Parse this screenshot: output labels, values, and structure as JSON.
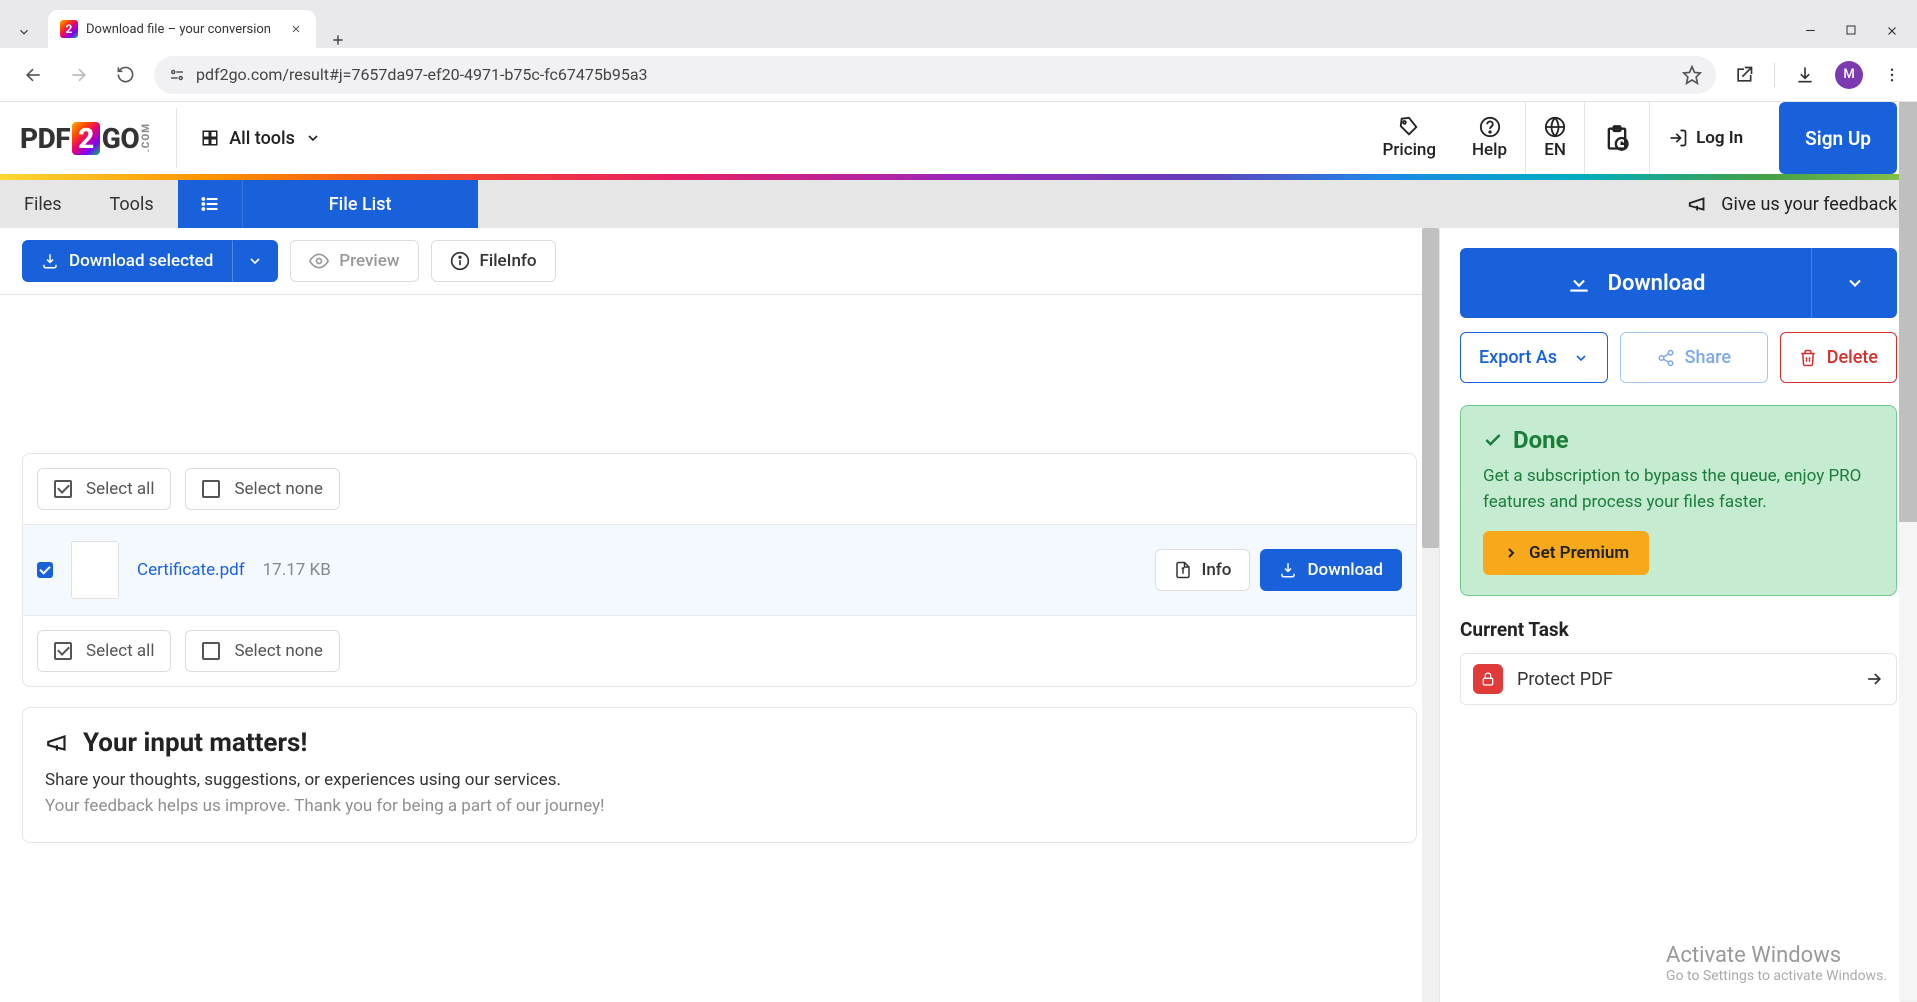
{
  "browser": {
    "tab_title": "Download file – your conversion",
    "url": "pdf2go.com/result#j=7657da97-ef20-4971-b75c-fc67475b95a3",
    "profile_initial": "M"
  },
  "header": {
    "logo_pdf": "PDF",
    "logo_2": "2",
    "logo_go": "GO",
    "logo_com": ".COM",
    "all_tools": "All tools",
    "pricing": "Pricing",
    "help": "Help",
    "lang": "EN",
    "login": "Log In",
    "signup": "Sign Up"
  },
  "toolbar": {
    "files": "Files",
    "tools": "Tools",
    "file_list": "File List",
    "feedback": "Give us your feedback"
  },
  "actions": {
    "download_selected": "Download selected",
    "preview": "Preview",
    "file_info": "FileInfo"
  },
  "selectors": {
    "select_all": "Select all",
    "select_none": "Select none"
  },
  "file": {
    "name": "Certificate.pdf",
    "size": "17.17 KB",
    "info": "Info",
    "download": "Download"
  },
  "right": {
    "download": "Download",
    "export_as": "Export As",
    "share": "Share",
    "delete": "Delete",
    "done": "Done",
    "done_text": "Get a subscription to bypass the queue, enjoy PRO features and process your files faster.",
    "get_premium": "Get Premium",
    "current_task": "Current Task",
    "protect_pdf": "Protect PDF"
  },
  "feedback_card": {
    "title": "Your input matters!",
    "line1": "Share your thoughts, suggestions, or experiences using our services.",
    "line2": "Your feedback helps us improve. Thank you for being a part of our journey!"
  },
  "watermark": {
    "title": "Activate Windows",
    "sub": "Go to Settings to activate Windows."
  }
}
